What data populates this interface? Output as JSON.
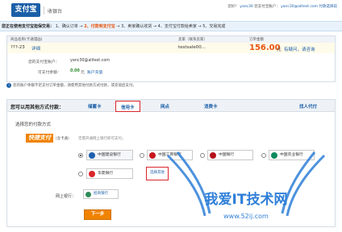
{
  "header": {
    "logo_text": "支付宝",
    "cashier": "收银台",
    "user_greeting": "您好！",
    "username": "yanc30",
    "account_label": "您支付宝账户：",
    "account_email": "yanc30@alitest.com",
    "account_suffix": "付款选择前"
  },
  "steps": {
    "lead": "您正在使用支付宝担保交易：",
    "step1": "1、确认订单",
    "arrow1": "→",
    "step2": "2、付款到支付宝",
    "arrow2": "→",
    "step3": "3、卖家确认收货",
    "arrow3": "→",
    "step4": "4、支付宝付款给卖家",
    "arrow4": "→",
    "step5": "5、交易完成"
  },
  "order": {
    "col_name": "商品名称(卡通漫画)",
    "col_seller": "卖家（联系卖家）",
    "col_total": "订单金额",
    "item_name": "???-23",
    "item_link": "详细",
    "seller": "testsale00...",
    "price": "156.00",
    "price_unit": "元",
    "price_note": "有疑问，请咨询"
  },
  "account": {
    "label_account": "您的支付宝账户：",
    "account_value": "yanc30@alitest.com",
    "label_balance": "可支付余额：",
    "balance_value": "0.00",
    "balance_unit": "元",
    "recharge_link": "账户充值"
  },
  "notice": {
    "icon": "i",
    "text": "您的账户余额不足支付订单金额，请使用其他付款方式付款，或充值后支付。"
  },
  "tabs": {
    "lead": "您可以用其他方式付款：",
    "items": [
      "储蓄卡",
      "信用卡",
      "网点",
      "消费卡",
      "找人代付"
    ],
    "active": "信用卡"
  },
  "panel": {
    "choose_title": "选择您的付款方式",
    "kuaijie_label": "快捷支付",
    "kuaijie_sub": "（含卡通）",
    "kuaijie_desc": "无需开通网上银行即可支付。",
    "banks": [
      "中国建设银行",
      "中国工商银行",
      "中国银行",
      "中国农业银行",
      "华夏银行"
    ],
    "choose_other": "选择其他",
    "online_label": "网上银行：",
    "online_bank": "招商银行",
    "next_button": "下一步"
  },
  "watermark": {
    "text": "我爱IT技术网",
    "url": "www.52ij.com"
  },
  "colors": {
    "brand": "#1b5fa8",
    "accent": "#e8540f",
    "button": "#f08300",
    "highlight": "#d9262c",
    "watermark": "#2f7fd8"
  }
}
